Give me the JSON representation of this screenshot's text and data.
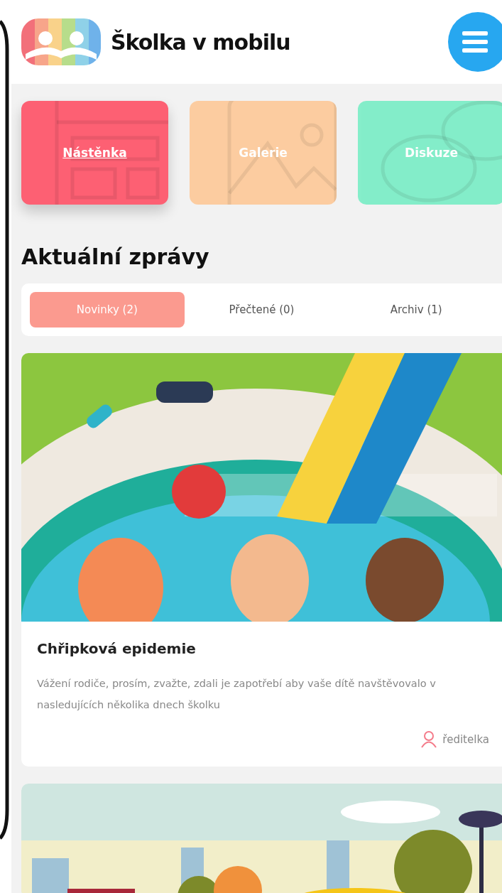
{
  "header": {
    "app_name": "Školka v mobilu"
  },
  "tiles": [
    {
      "label": "Nástěnka",
      "color": "#fd6073",
      "selected": true
    },
    {
      "label": "Galerie",
      "color": "#fdcb9c",
      "selected": false
    },
    {
      "label": "Diskuze",
      "color": "#7eedc7",
      "selected": false
    }
  ],
  "section_title": "Aktuální zprávy",
  "tabs": [
    {
      "label": "Novinky (2)",
      "selected": true
    },
    {
      "label": "Přečtené (0)",
      "selected": false
    },
    {
      "label": "Archiv (1)",
      "selected": false
    }
  ],
  "news": [
    {
      "kind": "pool",
      "title": "Chřipková epidemie",
      "text": "Vážení rodiče, prosím, zvažte, zdali je zapotřebí aby vaše dítě navštěvovalo v nasledujících několika dnech školku",
      "author": "ředitelka"
    },
    {
      "kind": "park"
    }
  ]
}
